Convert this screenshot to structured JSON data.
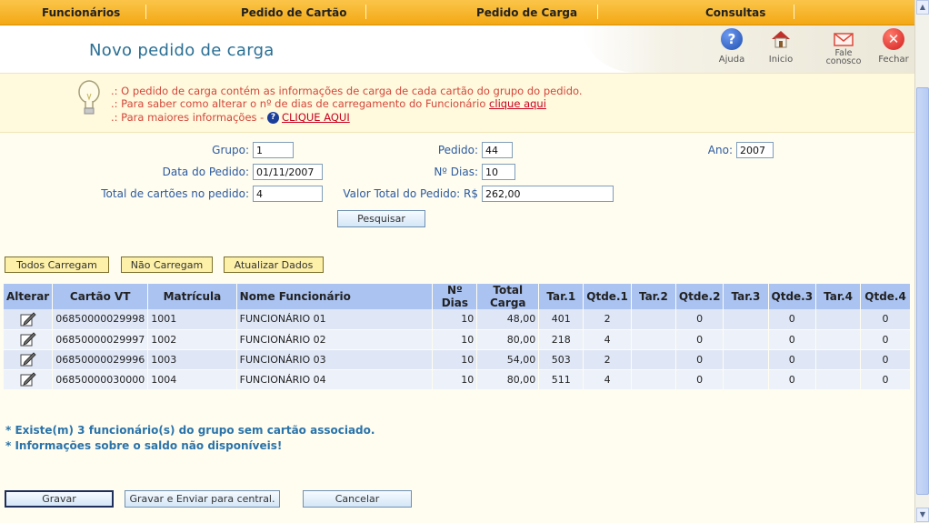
{
  "menu": [
    "Funcionários",
    "Pedido de Cartão",
    "Pedido de Carga",
    "Consultas"
  ],
  "page_title": "Novo pedido de carga",
  "header_icons": [
    {
      "label": "Ajuda",
      "icon": "help-icon",
      "color": "#1f4fb0"
    },
    {
      "label": "Inicio",
      "icon": "home-icon",
      "color": "#c0302b"
    },
    {
      "label_line1": "Fale",
      "label_line2": "conosco",
      "icon": "mail-icon",
      "color": "#d94a3a"
    },
    {
      "label": "Fechar",
      "icon": "close-icon",
      "color": "#d21f1f"
    }
  ],
  "info": {
    "line1": ".: O pedido de carga contém as informações de carga de cada cartão do grupo do pedido.",
    "line2_prefix": ".: Para saber como alterar o nº de dias de carregamento do Funcionário ",
    "line2_link": "clique aqui",
    "line3_prefix": ".: Para maiores informações - ",
    "line3_link": "CLIQUE AQUI"
  },
  "form": {
    "grupo_label": "Grupo:",
    "grupo_value": "1",
    "pedido_label": "Pedido:",
    "pedido_value": "44",
    "ano_label": "Ano:",
    "ano_value": "2007",
    "data_label": "Data do Pedido:",
    "data_value": "01/11/2007",
    "dias_label": "Nº Dias:",
    "dias_value": "10",
    "total_cartoes_label": "Total de cartões no pedido:",
    "total_cartoes_value": "4",
    "valor_total_label": "Valor Total do Pedido: R$",
    "valor_total_value": "262,00",
    "pesquisar_label": "Pesquisar"
  },
  "actions": {
    "todos": "Todos Carregam",
    "nao": "Não Carregam",
    "atualizar": "Atualizar Dados"
  },
  "table": {
    "headers": [
      "Alterar",
      "Cartão VT",
      "Matrícula",
      "Nome Funcionário",
      "Nº Dias",
      "Total Carga",
      "Tar.1",
      "Qtde.1",
      "Tar.2",
      "Qtde.2",
      "Tar.3",
      "Qtde.3",
      "Tar.4",
      "Qtde.4"
    ],
    "rows": [
      {
        "cartao": "06850000029998",
        "matricula": "1001",
        "nome": "FUNCIONÁRIO 01",
        "dias": "10",
        "total": "48,00",
        "tar1": "401",
        "qtde1": "2",
        "tar2": "",
        "qtde2": "0",
        "tar3": "",
        "qtde3": "0",
        "tar4": "",
        "qtde4": "0"
      },
      {
        "cartao": "06850000029997",
        "matricula": "1002",
        "nome": "FUNCIONÁRIO 02",
        "dias": "10",
        "total": "80,00",
        "tar1": "218",
        "qtde1": "4",
        "tar2": "",
        "qtde2": "0",
        "tar3": "",
        "qtde3": "0",
        "tar4": "",
        "qtde4": "0"
      },
      {
        "cartao": "06850000029996",
        "matricula": "1003",
        "nome": "FUNCIONÁRIO 03",
        "dias": "10",
        "total": "54,00",
        "tar1": "503",
        "qtde1": "2",
        "tar2": "",
        "qtde2": "0",
        "tar3": "",
        "qtde3": "0",
        "tar4": "",
        "qtde4": "0"
      },
      {
        "cartao": "06850000030000",
        "matricula": "1004",
        "nome": "FUNCIONÁRIO 04",
        "dias": "10",
        "total": "80,00",
        "tar1": "511",
        "qtde1": "4",
        "tar2": "",
        "qtde2": "0",
        "tar3": "",
        "qtde3": "0",
        "tar4": "",
        "qtde4": "0"
      }
    ]
  },
  "notes": [
    "* Existe(m) 3 funcionário(s) do grupo sem cartão associado.",
    "* Informações sobre o saldo não disponíveis!"
  ],
  "footer": {
    "gravar": "Gravar",
    "gravar_enviar": "Gravar e Enviar para central.",
    "cancelar": "Cancelar"
  }
}
